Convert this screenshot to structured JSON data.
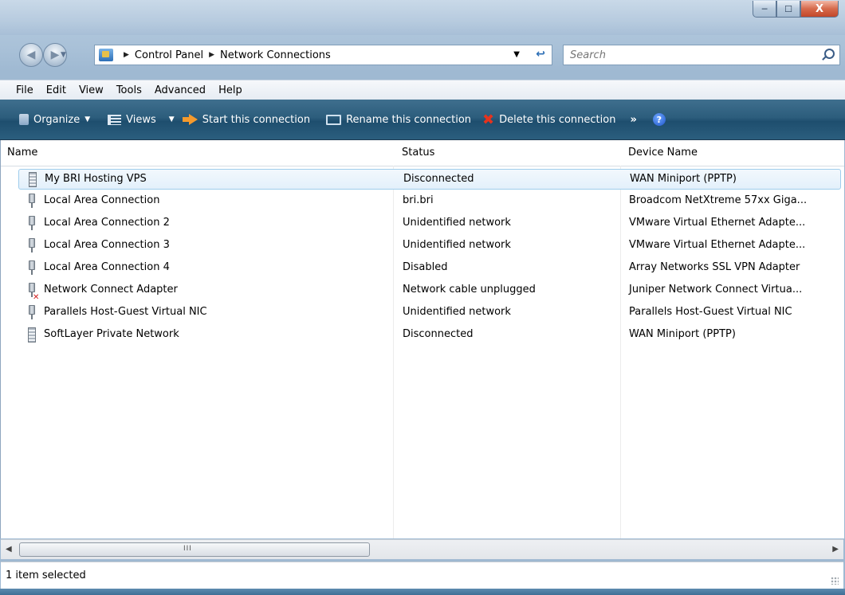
{
  "window": {
    "minimize": "─",
    "maximize": "☐",
    "close": "X"
  },
  "nav": {
    "back": "◀",
    "forward": "▶",
    "breadcrumb": [
      "Control Panel",
      "Network Connections"
    ],
    "search_placeholder": "Search"
  },
  "menubar": [
    "File",
    "Edit",
    "View",
    "Tools",
    "Advanced",
    "Help"
  ],
  "toolbar": {
    "organize": "Organize",
    "views": "Views",
    "start": "Start this connection",
    "rename": "Rename this connection",
    "delete": "Delete this connection",
    "more": "»",
    "help": "?"
  },
  "columns": [
    "Name",
    "Status",
    "Device Name"
  ],
  "rows": [
    {
      "name": "My BRI Hosting VPS",
      "status": "Disconnected",
      "device": "WAN Miniport (PPTP)",
      "icon": "vpn-modem-icon",
      "selected": true
    },
    {
      "name": "Local Area Connection",
      "status": "bri.bri",
      "device": "Broadcom NetXtreme 57xx Giga...",
      "icon": "lan-plug-icon"
    },
    {
      "name": "Local Area Connection 2",
      "status": "Unidentified network",
      "device": "VMware Virtual Ethernet Adapte...",
      "icon": "lan-plug-icon"
    },
    {
      "name": "Local Area Connection 3",
      "status": "Unidentified network",
      "device": "VMware Virtual Ethernet Adapte...",
      "icon": "lan-plug-icon"
    },
    {
      "name": "Local Area Connection 4",
      "status": "Disabled",
      "device": "Array Networks SSL VPN Adapter",
      "icon": "lan-plug-icon"
    },
    {
      "name": "Network Connect Adapter",
      "status": "Network cable unplugged",
      "device": "Juniper Network Connect Virtua...",
      "icon": "lan-plug-unplugged-icon"
    },
    {
      "name": "Parallels Host-Guest Virtual NIC",
      "status": "Unidentified network",
      "device": "Parallels Host-Guest Virtual NIC",
      "icon": "lan-plug-icon"
    },
    {
      "name": "SoftLayer Private Network",
      "status": "Disconnected",
      "device": "WAN Miniport (PPTP)",
      "icon": "vpn-modem-icon"
    }
  ],
  "scrollbar": {
    "grip": "III"
  },
  "status": "1 item selected"
}
